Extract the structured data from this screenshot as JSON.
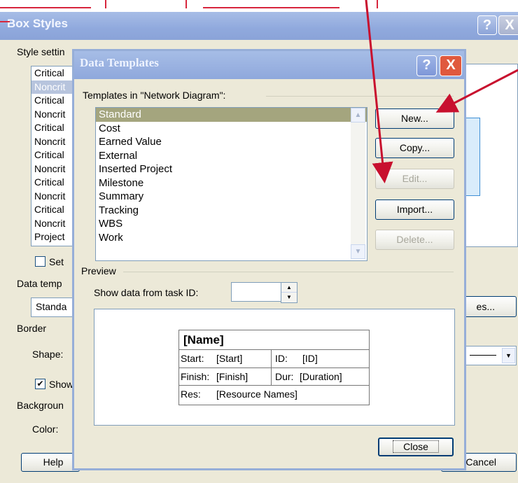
{
  "box_styles": {
    "title": "Box Styles",
    "help_glyph": "?",
    "close_glyph": "X",
    "style_settings_label": "Style settin",
    "style_list": [
      "Critical",
      "Noncrit",
      "Critical",
      "Noncrit",
      "Critical",
      "Noncrit",
      "Critical",
      "Noncrit",
      "Critical",
      "Noncrit",
      "Critical",
      "Noncrit",
      "Project"
    ],
    "selected_style_index": 1,
    "set_checkbox_label": "Set",
    "data_template_label": "Data temp",
    "data_template_value": "Standa",
    "more_templates_button": "es...",
    "border_label": "Border",
    "shape_label": "Shape:",
    "show_checkbox_label": "Show",
    "background_label": "Backgroun",
    "color_label": "Color:",
    "help_button": "Help",
    "cancel_button": "Cancel"
  },
  "data_templates": {
    "title": "Data Templates",
    "help_glyph": "?",
    "close_glyph": "X",
    "templates_label": "Templates in \"Network Diagram\":",
    "templates": [
      "Standard",
      "Cost",
      "Earned Value",
      "External",
      "Inserted Project",
      "Milestone",
      "Summary",
      "Tracking",
      "WBS",
      "Work"
    ],
    "selected_template_index": 0,
    "buttons": {
      "new": "New...",
      "copy": "Copy...",
      "edit": "Edit...",
      "import": "Import...",
      "delete": "Delete...",
      "close": "Close"
    },
    "preview_label": "Preview",
    "show_data_label": "Show data from task ID:",
    "task_id_value": "",
    "preview_card": {
      "name": "[Name]",
      "start_label": "Start:",
      "start_value": "[Start]",
      "id_label": "ID:",
      "id_value": "[ID]",
      "finish_label": "Finish:",
      "finish_value": "[Finish]",
      "dur_label": "Dur:",
      "dur_value": "[Duration]",
      "res_label": "Res:",
      "res_value": "[Resource Names]"
    }
  },
  "colors": {
    "annotation_arrow": "#c8102e",
    "selected_template": "#a4a57e",
    "dialog_face": "#ece9d8"
  }
}
